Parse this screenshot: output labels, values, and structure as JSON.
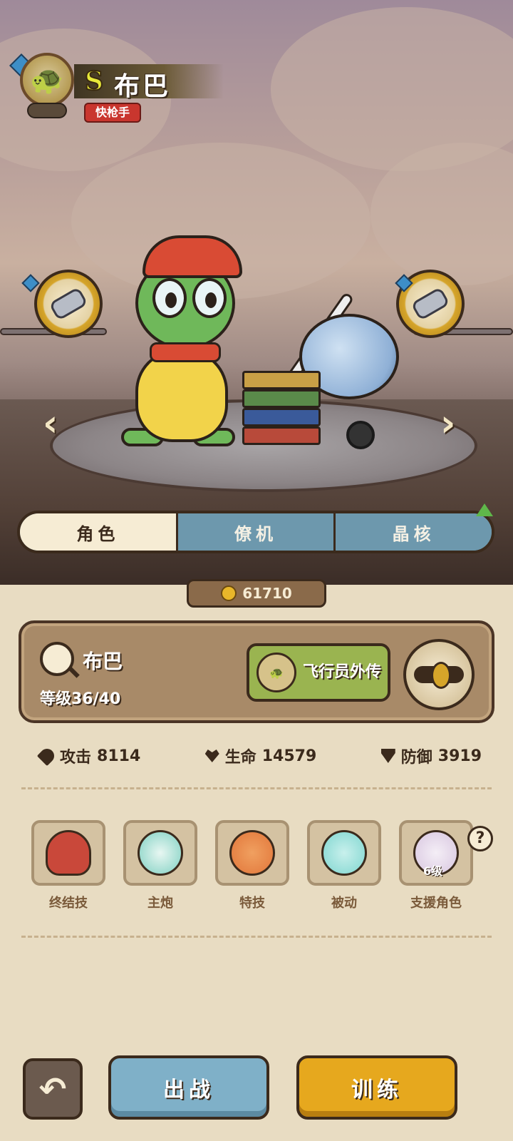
{
  "character": {
    "rank": "S",
    "name": "布巴",
    "role": "快枪手"
  },
  "tabs": [
    {
      "label": "角色",
      "active": true
    },
    {
      "label": "僚机",
      "active": false
    },
    {
      "label": "晶核",
      "active": false
    }
  ],
  "currency": {
    "value": "61710",
    "icon": "coin-icon"
  },
  "info": {
    "name": "布巴",
    "level": "等级36/40",
    "story_label": "飞行员外传"
  },
  "stats": [
    {
      "label": "攻击",
      "value": "8114",
      "icon": "bullet-icon"
    },
    {
      "label": "生命",
      "value": "14579",
      "icon": "heart-icon"
    },
    {
      "label": "防御",
      "value": "3919",
      "icon": "shield-icon"
    }
  ],
  "skills": [
    {
      "label": "终结技",
      "icon": "shell-icon",
      "color": "#c9483a"
    },
    {
      "label": "主炮",
      "icon": "soccer-ball-icon",
      "color": "#7fd0c2"
    },
    {
      "label": "特技",
      "icon": "basketball-icon",
      "color": "#e2763a"
    },
    {
      "label": "被动",
      "icon": "spiked-shell-icon",
      "color": "#7fd6d0"
    },
    {
      "label": "支援角色",
      "icon": "support-character-icon",
      "color": "#d8c6e0",
      "level": "6级"
    }
  ],
  "help": "?",
  "buttons": {
    "back": "↶",
    "battle": "出战",
    "train": "训练"
  },
  "nav": {
    "prev": "‹",
    "next": "›"
  }
}
